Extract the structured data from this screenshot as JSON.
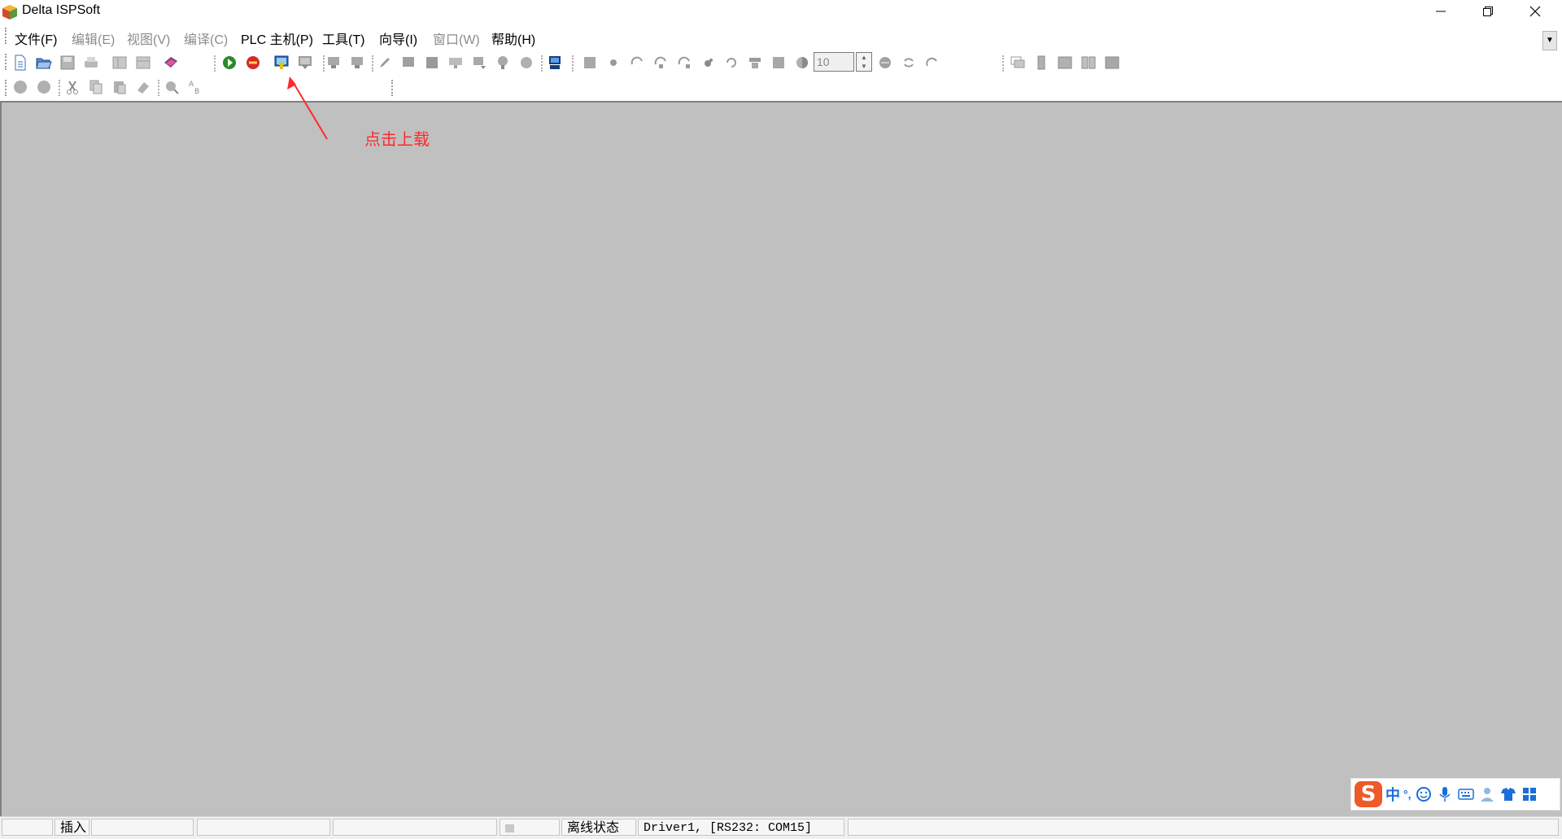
{
  "window": {
    "title": "Delta ISPSoft",
    "minimize": "—",
    "maximize": "□",
    "close": "✕"
  },
  "menu": [
    {
      "label": "文件(F)",
      "enabled": true
    },
    {
      "label": "编辑(E)",
      "enabled": false
    },
    {
      "label": "视图(V)",
      "enabled": false
    },
    {
      "label": "编译(C)",
      "enabled": false
    },
    {
      "label": "PLC 主机(P)",
      "enabled": true
    },
    {
      "label": "工具(T)",
      "enabled": true
    },
    {
      "label": "向导(I)",
      "enabled": true
    },
    {
      "label": "窗口(W)",
      "enabled": false
    },
    {
      "label": "帮助(H)",
      "enabled": true
    }
  ],
  "toolbar": {
    "zoom_value": "10",
    "icons": [
      "new-file-icon",
      "open-folder-icon",
      "save-icon",
      "print-icon",
      "layout-icon",
      "window-icon",
      "book-icon",
      "run-icon",
      "stop-icon",
      "upload-icon",
      "download-icon"
    ]
  },
  "annotation": {
    "text": "点击上载",
    "color": "#ff2a2a"
  },
  "status": {
    "mode": "插入",
    "connection_state": "离线状态",
    "driver": "Driver1,  [RS232: COM15]"
  },
  "ime": {
    "lang": "中",
    "punct": "°,"
  },
  "colors": {
    "workspace": "#c0c0c0",
    "annotation": "#ff2a2a",
    "ime_logo": "#ee5a2a",
    "ime_accent": "#1a6fd9"
  }
}
